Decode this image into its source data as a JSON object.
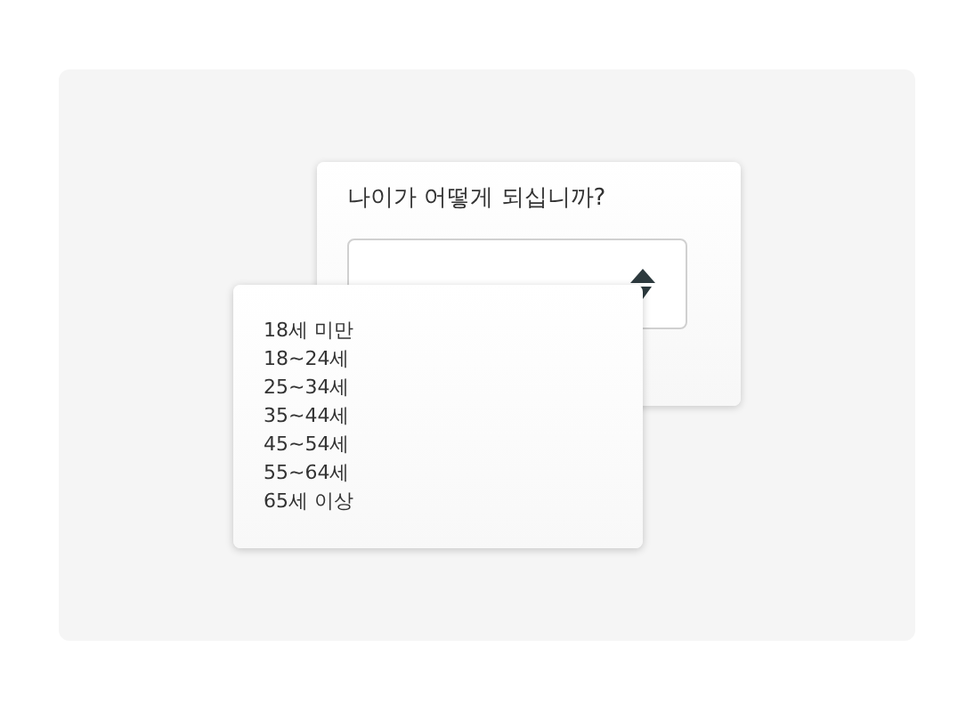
{
  "question": {
    "label": "나이가 어떻게 되십니까?"
  },
  "dropdown": {
    "options": [
      {
        "label": "18세 미만"
      },
      {
        "label": "18~24세"
      },
      {
        "label": "25~34세"
      },
      {
        "label": "35~44세"
      },
      {
        "label": "45~54세"
      },
      {
        "label": "55~64세"
      },
      {
        "label": "65세 이상"
      }
    ]
  }
}
